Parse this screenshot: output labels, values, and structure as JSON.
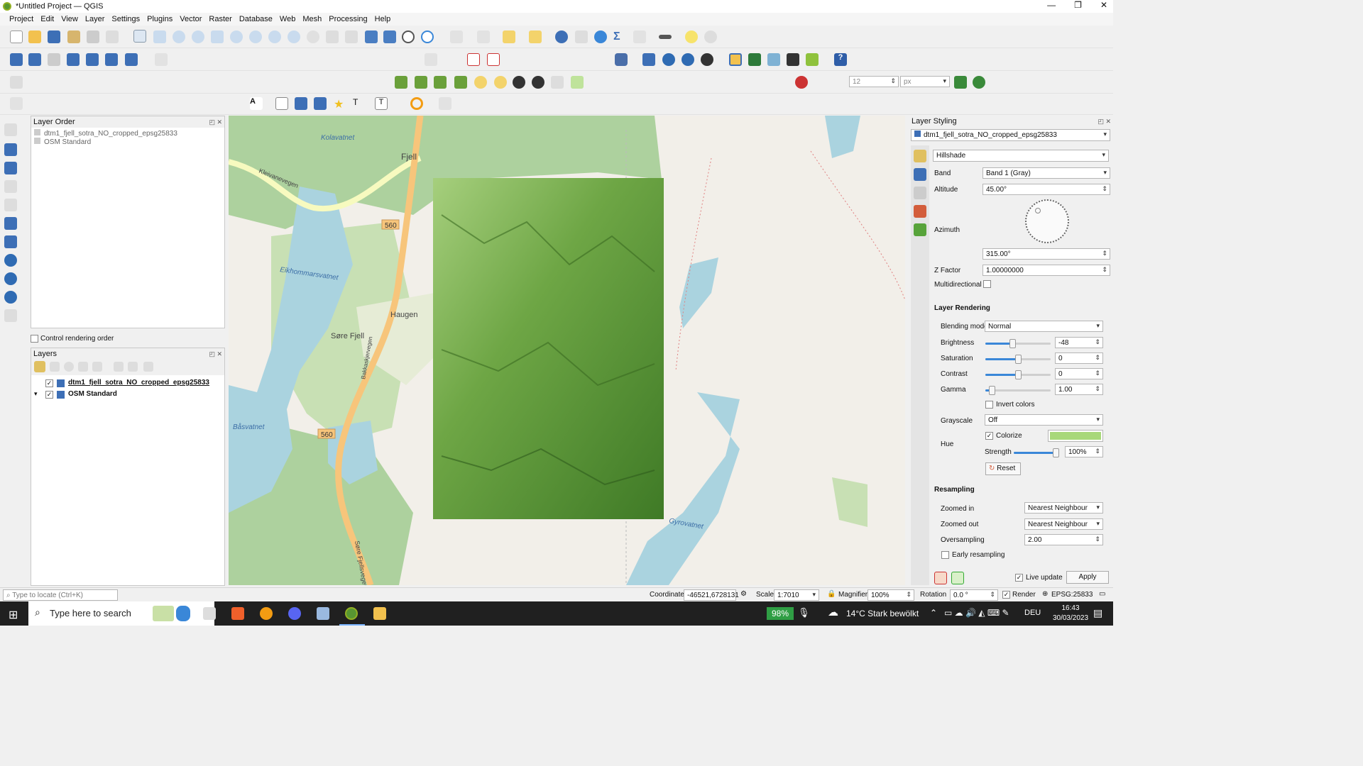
{
  "window": {
    "title": "*Untitled Project — QGIS",
    "min": "—",
    "max": "❐",
    "close": "✕"
  },
  "menu": [
    "Project",
    "Edit",
    "View",
    "Layer",
    "Settings",
    "Plugins",
    "Vector",
    "Raster",
    "Database",
    "Web",
    "Mesh",
    "Processing",
    "Help"
  ],
  "snapping": {
    "tolerance": "12",
    "unit": "px"
  },
  "layer_order_panel": {
    "title": "Layer Order",
    "items": [
      "dtm1_fjell_sotra_NO_cropped_epsg25833",
      "OSM Standard"
    ],
    "control_rendering_order": "Control rendering order"
  },
  "layers_panel": {
    "title": "Layers",
    "items": [
      {
        "name": "dtm1_fjell_sotra_NO_cropped_epsg25833",
        "checked": true
      },
      {
        "name": "OSM Standard",
        "checked": true
      }
    ]
  },
  "map_labels": [
    "Kolavatnet",
    "Fjell",
    "Kleivanevegen",
    "560",
    "Eikhommarsvatnet",
    "Haugen",
    "Søre Fjell",
    "Bakkaskjervegen",
    "Båsvatnet",
    "560",
    "Søre Fjellsvegen",
    "Gyrovatnet"
  ],
  "styling": {
    "title": "Layer Styling",
    "layer": "dtm1_fjell_sotra_NO_cropped_epsg25833",
    "renderer": "Hillshade",
    "band_label": "Band",
    "band": "Band 1 (Gray)",
    "altitude_label": "Altitude",
    "altitude": "45.00°",
    "azimuth_label": "Azimuth",
    "azimuth": "315.00°",
    "zfactor_label": "Z Factor",
    "zfactor": "1.00000000",
    "multidirectional_label": "Multidirectional",
    "rendering_title": "Layer Rendering",
    "blending_label": "Blending mode",
    "blending": "Normal",
    "brightness_label": "Brightness",
    "brightness": "-48",
    "brightness_frac": 0.41,
    "saturation_label": "Saturation",
    "saturation": "0",
    "saturation_frac": 0.5,
    "contrast_label": "Contrast",
    "contrast": "0",
    "contrast_frac": 0.5,
    "gamma_label": "Gamma",
    "gamma": "1.00",
    "gamma_frac": 0.1,
    "invert_label": "Invert colors",
    "grayscale_label": "Grayscale",
    "grayscale": "Off",
    "hue_label": "Hue",
    "colorize_label": "Colorize",
    "colorize_color": "#a8d87a",
    "strength_label": "Strength",
    "strength": "100%",
    "strength_frac": 1.0,
    "reset_label": "Reset",
    "resampling_title": "Resampling",
    "zoomed_in_label": "Zoomed in",
    "zoomed_in": "Nearest Neighbour",
    "zoomed_out_label": "Zoomed out",
    "zoomed_out": "Nearest Neighbour",
    "oversampling_label": "Oversampling",
    "oversampling": "2.00",
    "early_label": "Early resampling",
    "live_update_label": "Live update",
    "apply_label": "Apply"
  },
  "status": {
    "locate_placeholder": "Type to locate (Ctrl+K)",
    "coordinate_label": "Coordinate",
    "coordinate": "-46521,6728131",
    "scale_label": "Scale",
    "scale": "1:7010",
    "magnifier_label": "Magnifier",
    "magnifier": "100%",
    "rotation_label": "Rotation",
    "rotation": "0.0 °",
    "render_label": "Render",
    "crs": "EPSG:25833"
  },
  "taskbar": {
    "search": "Type here to search",
    "battery": "98%",
    "weather": "14°C  Stark bewölkt",
    "lang": "DEU",
    "time": "16:43",
    "date": "30/03/2023"
  },
  "colors": {
    "hillshade": "#5f9a3a",
    "water": "#aad3df",
    "forest": "#add19e",
    "road": "#f7c57b"
  }
}
